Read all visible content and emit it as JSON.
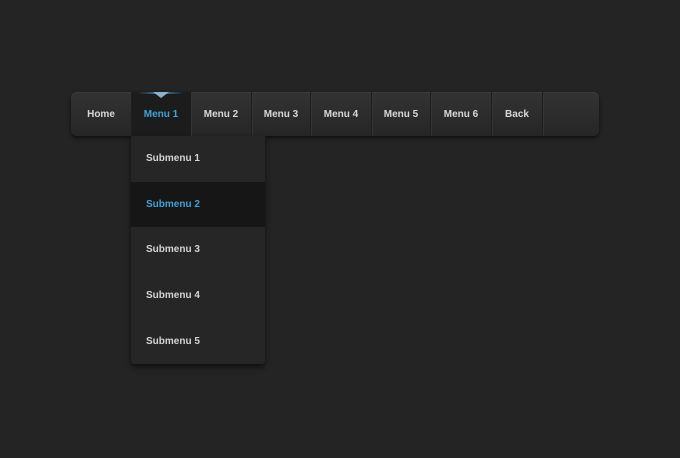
{
  "nav": {
    "items": [
      {
        "label": "Home"
      },
      {
        "label": "Menu 1"
      },
      {
        "label": "Menu 2"
      },
      {
        "label": "Menu 3"
      },
      {
        "label": "Menu 4"
      },
      {
        "label": "Menu 5"
      },
      {
        "label": "Menu 6"
      },
      {
        "label": "Back"
      }
    ],
    "active_index": 1
  },
  "submenu": {
    "items": [
      {
        "label": "Submenu 1"
      },
      {
        "label": "Submenu 2"
      },
      {
        "label": "Submenu 3"
      },
      {
        "label": "Submenu 4"
      },
      {
        "label": "Submenu 5"
      }
    ],
    "active_index": 1
  },
  "colors": {
    "background": "#242424",
    "accent": "#3fa3d6",
    "text": "#d8d8d8"
  }
}
